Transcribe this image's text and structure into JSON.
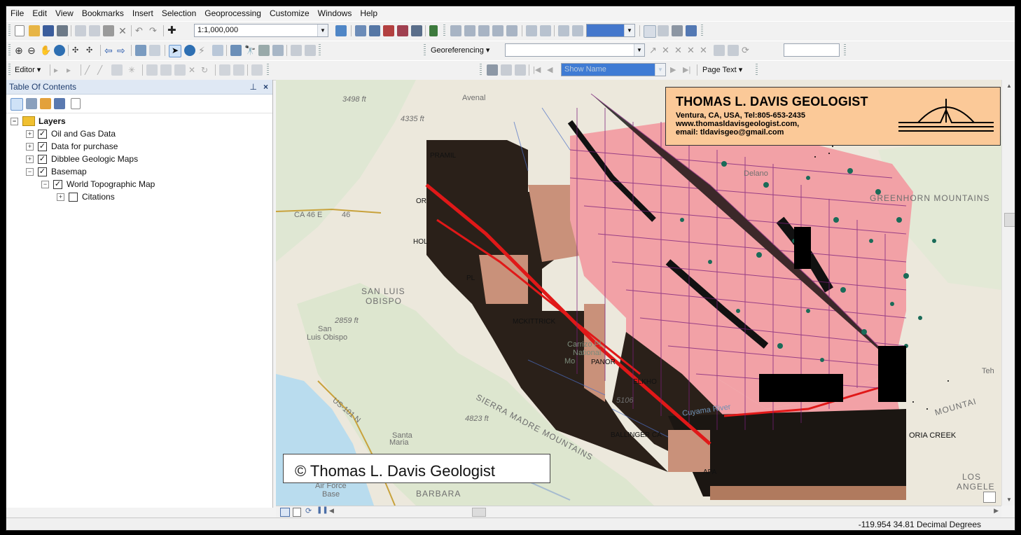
{
  "menu": [
    "File",
    "Edit",
    "View",
    "Bookmarks",
    "Insert",
    "Selection",
    "Geoprocessing",
    "Customize",
    "Windows",
    "Help"
  ],
  "toolbar": {
    "scale": "1:1,000,000",
    "georeferencing_label": "Georeferencing",
    "editor_label": "Editor",
    "show_name_value": "Show Name",
    "page_text_label": "Page Text"
  },
  "toc": {
    "title": "Table Of Contents",
    "pin": "&#x1F4CC;",
    "close": "×",
    "items": [
      {
        "label": "Layers",
        "checked": null,
        "expanded": true
      },
      {
        "label": "Oil and Gas Data",
        "checked": true,
        "expanded": false
      },
      {
        "label": "Data for purchase",
        "checked": true,
        "expanded": false
      },
      {
        "label": "Dibblee Geologic Maps",
        "checked": true,
        "expanded": false
      },
      {
        "label": "Basemap",
        "checked": true,
        "expanded": true
      },
      {
        "label": "World Topographic Map",
        "checked": true,
        "expanded": true
      },
      {
        "label": "Citations",
        "checked": false,
        "expanded": false
      }
    ]
  },
  "map": {
    "banner": {
      "title": "THOMAS L. DAVIS GEOLOGIST",
      "line1": "Ventura, CA, USA, Tel:805-653-2435",
      "line2": "www.thomasldavisgeologist.com,",
      "line3": "email: tldavisgeo@gmail.com"
    },
    "copyright": "© Thomas L. Davis Geologist",
    "labels": {
      "avenal": "Avenal",
      "e3498": "3498 ft",
      "e4335": "4335 ft",
      "delano": "Delano",
      "greenhorn": "GREENHORN MOUNTAINS",
      "ca46": "CA 46 E",
      "n46": "46",
      "sanluis_a": "SAN LUIS",
      "sanluis_b": "OBISPO",
      "e2859": "2859 ft",
      "san": "San",
      "luisobispo": "Luis Obispo",
      "mckittrick": "MCKITTRICK",
      "carrizo_a": "Carrizo Pl",
      "carrizo_b": "National",
      "carrizo_c": "Mo",
      "panorama": "PANOR",
      "sierra": "SIERRA MADRE MOUNTAINS",
      "e4823": "4823 ft",
      "santa": "Santa",
      "maria": "Maria",
      "ballinger": "BALLINGER CA",
      "elkhorn": "ELKHO",
      "e5106": "5106",
      "victoria": "ORIA CREEK",
      "teh": "Teh",
      "los": "LOS",
      "angeles": "ANGELE",
      "airforce": "Air Force",
      "base": "Base",
      "barbara": "BARBARA",
      "us101": "US-101 N",
      "mountains": "MOUNTAI",
      "ol": "OR",
      "hol": "HOL",
      "apa": "APA",
      "cuyama": "Cuyama River",
      "pl": "PL",
      "fm": "PRAMIL"
    }
  },
  "status": {
    "coordinates": "-119.954  34.81 Decimal Degrees"
  },
  "colors": {
    "banner_bg": "#fbc998",
    "geology_pink": "#f2a1a6",
    "fault_red": "#e01818",
    "well_green": "#1a6b58",
    "line_purple": "#7a1e7a"
  }
}
